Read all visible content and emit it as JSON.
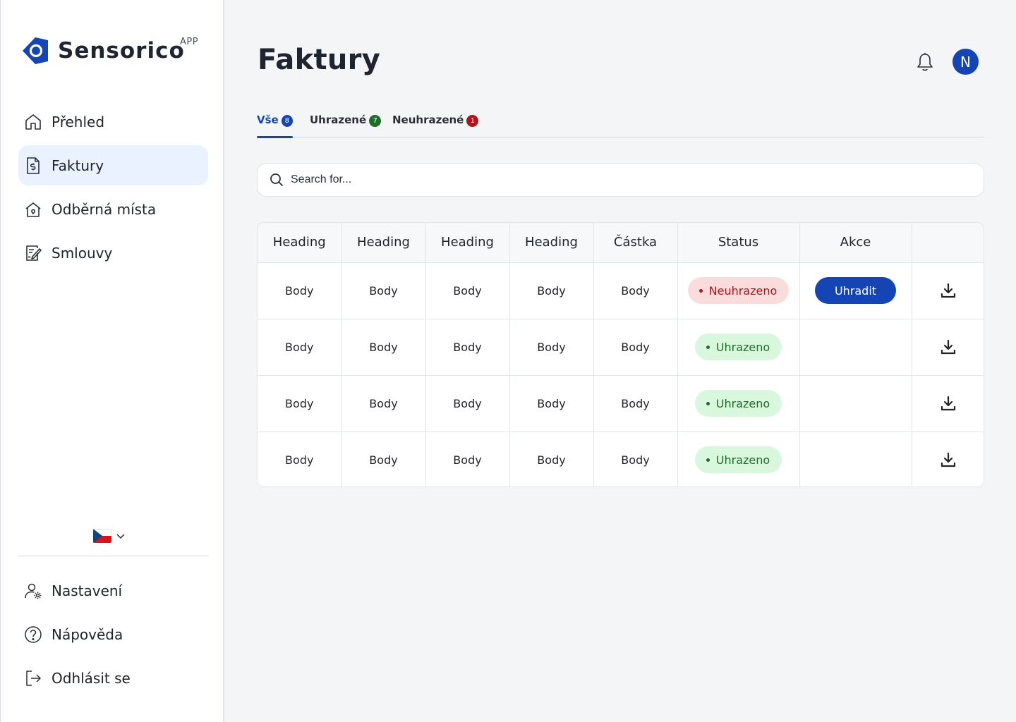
{
  "brand": {
    "name": "Sensorico",
    "suffix": "APP",
    "color": "#1545b5"
  },
  "sidebar": {
    "items": [
      {
        "label": "Přehled",
        "icon": "home-icon",
        "active": false
      },
      {
        "label": "Faktury",
        "icon": "invoice-icon",
        "active": true
      },
      {
        "label": "Odběrná místa",
        "icon": "house-pin-icon",
        "active": false
      },
      {
        "label": "Smlouvy",
        "icon": "contract-icon",
        "active": false
      }
    ],
    "language": {
      "flag": "czech-flag-icon"
    },
    "bottom_items": [
      {
        "label": "Nastavení",
        "icon": "user-settings-icon"
      },
      {
        "label": "Nápověda",
        "icon": "help-icon"
      },
      {
        "label": "Odhlásit se",
        "icon": "logout-icon"
      }
    ]
  },
  "header": {
    "title": "Faktury",
    "avatar_initial": "N"
  },
  "tabs": [
    {
      "label": "Vše",
      "count": "8",
      "color": "#1545b5",
      "active": true
    },
    {
      "label": "Uhrazené",
      "count": "7",
      "color": "#1e6e2a",
      "active": false
    },
    {
      "label": "Neuhrazené",
      "count": "1",
      "color": "#b0141a",
      "active": false
    }
  ],
  "search": {
    "placeholder": "Search for..."
  },
  "table": {
    "headers": [
      "Heading",
      "Heading",
      "Heading",
      "Heading",
      "Částka",
      "Status",
      "Akce",
      ""
    ],
    "rows": [
      {
        "cells": [
          "Body",
          "Body",
          "Body",
          "Body",
          "Body"
        ],
        "status": "Neuhrazeno",
        "status_kind": "unpaid",
        "action": "Uhradit"
      },
      {
        "cells": [
          "Body",
          "Body",
          "Body",
          "Body",
          "Body"
        ],
        "status": "Uhrazeno",
        "status_kind": "paid",
        "action": ""
      },
      {
        "cells": [
          "Body",
          "Body",
          "Body",
          "Body",
          "Body"
        ],
        "status": "Uhrazeno",
        "status_kind": "paid",
        "action": ""
      },
      {
        "cells": [
          "Body",
          "Body",
          "Body",
          "Body",
          "Body"
        ],
        "status": "Uhrazeno",
        "status_kind": "paid",
        "action": ""
      }
    ]
  }
}
